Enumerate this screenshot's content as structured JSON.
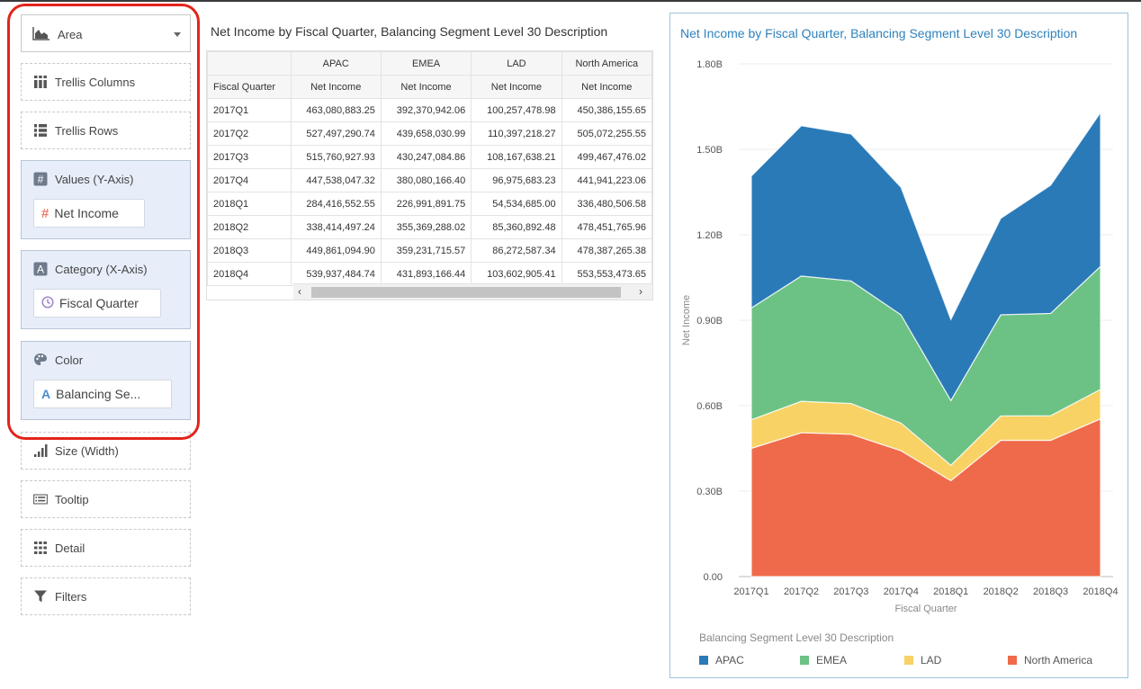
{
  "grammar": {
    "chart_type": "Area",
    "trellis_columns": "Trellis Columns",
    "trellis_rows": "Trellis Rows",
    "values_label": "Values (Y-Axis)",
    "values_item": "Net Income",
    "category_label": "Category (X-Axis)",
    "category_item": "Fiscal Quarter",
    "color_label": "Color",
    "color_item": "Balancing Se...",
    "size_label": "Size (Width)",
    "tooltip_label": "Tooltip",
    "detail_label": "Detail",
    "filters_label": "Filters"
  },
  "table": {
    "title": "Net Income by Fiscal Quarter, Balancing Segment Level 30 Description",
    "row_header": "Fiscal Quarter",
    "columns": [
      "APAC",
      "EMEA",
      "LAD",
      "North America"
    ],
    "measure": "Net Income",
    "rows": [
      {
        "q": "2017Q1",
        "v": [
          "463,080,883.25",
          "392,370,942.06",
          "100,257,478.98",
          "450,386,155.65"
        ]
      },
      {
        "q": "2017Q2",
        "v": [
          "527,497,290.74",
          "439,658,030.99",
          "110,397,218.27",
          "505,072,255.55"
        ]
      },
      {
        "q": "2017Q3",
        "v": [
          "515,760,927.93",
          "430,247,084.86",
          "108,167,638.21",
          "499,467,476.02"
        ]
      },
      {
        "q": "2017Q4",
        "v": [
          "447,538,047.32",
          "380,080,166.40",
          "96,975,683.23",
          "441,941,223.06"
        ]
      },
      {
        "q": "2018Q1",
        "v": [
          "284,416,552.55",
          "226,991,891.75",
          "54,534,685.00",
          "336,480,506.58"
        ]
      },
      {
        "q": "2018Q2",
        "v": [
          "338,414,497.24",
          "355,369,288.02",
          "85,360,892.48",
          "478,451,765.96"
        ]
      },
      {
        "q": "2018Q3",
        "v": [
          "449,861,094.90",
          "359,231,715.57",
          "86,272,587.34",
          "478,387,265.38"
        ]
      },
      {
        "q": "2018Q4",
        "v": [
          "539,937,484.74",
          "431,893,166.44",
          "103,602,905.41",
          "553,553,473.65"
        ]
      }
    ],
    "scroll_left": "‹",
    "scroll_right": "›"
  },
  "chart_data": {
    "type": "area",
    "stacked": true,
    "title": "Net Income by Fiscal Quarter, Balancing Segment Level 30 Description",
    "xlabel": "Fiscal Quarter",
    "ylabel": "Net Income",
    "ylim": [
      0,
      1.8
    ],
    "yticks": [
      "0.00",
      "0.30B",
      "0.60B",
      "0.90B",
      "1.20B",
      "1.50B",
      "1.80B"
    ],
    "categories": [
      "2017Q1",
      "2017Q2",
      "2017Q3",
      "2017Q4",
      "2018Q1",
      "2018Q2",
      "2018Q3",
      "2018Q4"
    ],
    "legend_title": "Balancing Segment Level 30 Description",
    "legend_position": "bottom",
    "grid": true,
    "series": [
      {
        "name": "North America",
        "color": "#ef6a4a",
        "values": [
          0.450386155,
          0.505072255,
          0.499467476,
          0.441941223,
          0.336480506,
          0.478451765,
          0.478387265,
          0.553553473
        ]
      },
      {
        "name": "LAD",
        "color": "#f8d264",
        "values": [
          0.100257478,
          0.110397218,
          0.108167638,
          0.096975683,
          0.054534685,
          0.085360892,
          0.086272587,
          0.103602905
        ]
      },
      {
        "name": "EMEA",
        "color": "#6cc284",
        "values": [
          0.392370942,
          0.43965803,
          0.430247084,
          0.380080166,
          0.226991891,
          0.355369288,
          0.359231715,
          0.431893166
        ]
      },
      {
        "name": "APAC",
        "color": "#2a7ab8",
        "values": [
          0.463080883,
          0.52749729,
          0.515760927,
          0.447538047,
          0.284416552,
          0.338414497,
          0.449861094,
          0.539937484
        ]
      }
    ],
    "legend_order": [
      "APAC",
      "EMEA",
      "LAD",
      "North America"
    ]
  }
}
